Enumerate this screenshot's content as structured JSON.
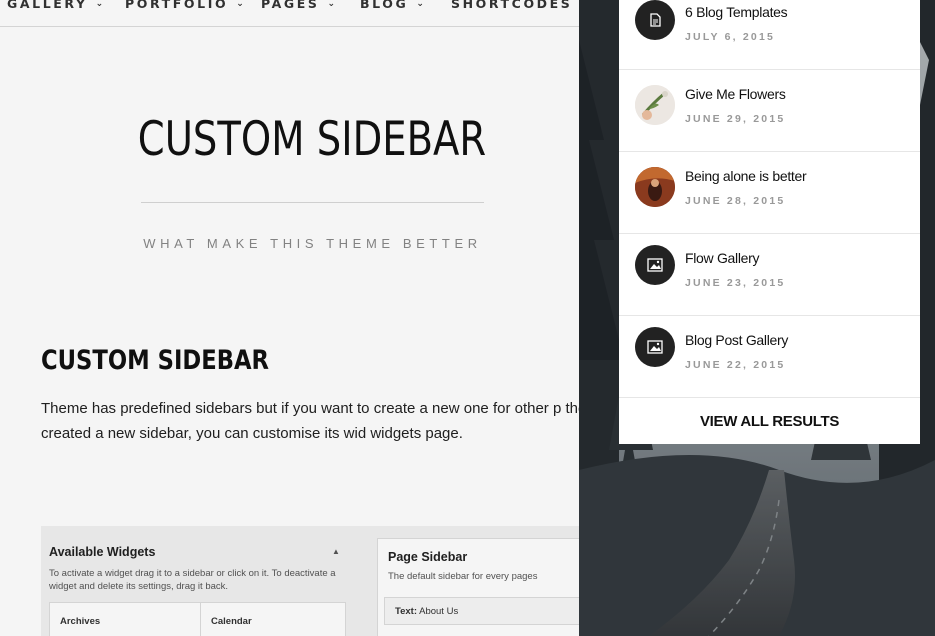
{
  "nav": {
    "items": [
      {
        "label": "GALLERY",
        "chevron": "chevron-down-icon"
      },
      {
        "label": "PORTFOLIO",
        "chevron": "chevron-down-icon"
      },
      {
        "label": "PAGES",
        "chevron": "chevron-down-icon"
      },
      {
        "label": "BLOG",
        "chevron": "chevron-down-icon"
      },
      {
        "label": "SHORTCODES",
        "chevron": "chevron-down-icon"
      }
    ]
  },
  "hero": {
    "title": "CUSTOM SIDEBAR",
    "subtitle": "WHAT MAKE THIS THEME BETTER"
  },
  "section": {
    "title": "CUSTOM SIDEBAR",
    "body": "Theme has predefined sidebars but if you want to create a new one for other p theme admin panel. Once you created a new sidebar, you can customise its wid widgets page."
  },
  "widgets_screenshot": {
    "available_title": "Available Widgets",
    "available_desc": "To activate a widget drag it to a sidebar or click on it. To deactivate a widget and delete its settings, drag it back.",
    "boxes": [
      "Archives",
      "Calendar"
    ],
    "page_sidebar_title": "Page Sidebar",
    "page_sidebar_desc": "The default sidebar for every pages",
    "text_widget_label": "Text:",
    "text_widget_value": "About Us"
  },
  "search_results": {
    "items": [
      {
        "title": "6 Blog Templates",
        "date": "JULY 6, 2015",
        "icon": "document-icon"
      },
      {
        "title": "Give Me Flowers",
        "date": "JUNE 29, 2015",
        "icon": "flowers-thumbnail"
      },
      {
        "title": "Being alone is better",
        "date": "JUNE 28, 2015",
        "icon": "portrait-thumbnail"
      },
      {
        "title": "Flow Gallery",
        "date": "JUNE 23, 2015",
        "icon": "image-icon"
      },
      {
        "title": "Blog Post Gallery",
        "date": "JUNE 22, 2015",
        "icon": "image-icon"
      }
    ],
    "view_all_label": "VIEW ALL RESULTS"
  },
  "colors": {
    "accent_dark": "#222222",
    "date_gray": "#999999",
    "photo_dark": "#2b3136"
  }
}
